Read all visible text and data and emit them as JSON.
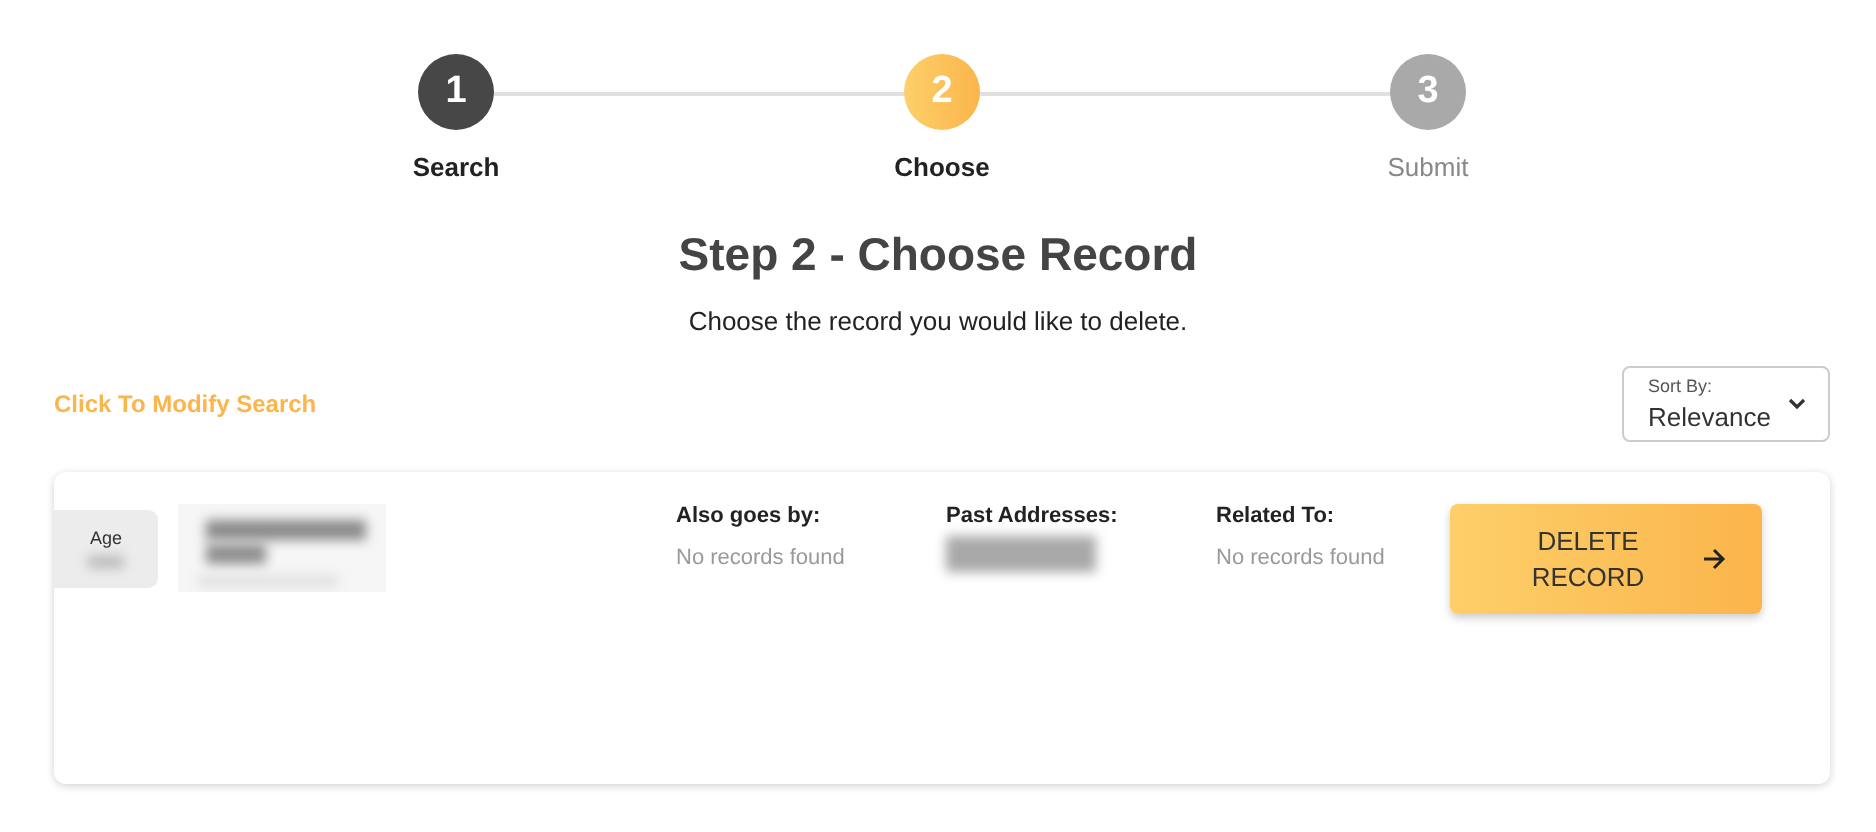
{
  "steps": [
    {
      "number": "1",
      "label": "Search",
      "kind": "done"
    },
    {
      "number": "2",
      "label": "Choose",
      "kind": "active"
    },
    {
      "number": "3",
      "label": "Submit",
      "kind": "upcoming"
    }
  ],
  "heading": "Step 2 - Choose Record",
  "subheading": "Choose the record you would like to delete.",
  "modify_link": "Click To Modify Search",
  "sort": {
    "label": "Sort By:",
    "value": "Relevance"
  },
  "record": {
    "age_label": "Age",
    "columns": [
      {
        "label": "Also goes by:",
        "value": "No records found",
        "kind": "text"
      },
      {
        "label": "Past Addresses:",
        "kind": "hidden"
      },
      {
        "label": "Related To:",
        "value": "No records found",
        "kind": "text"
      }
    ],
    "button": "DELETE RECORD"
  }
}
